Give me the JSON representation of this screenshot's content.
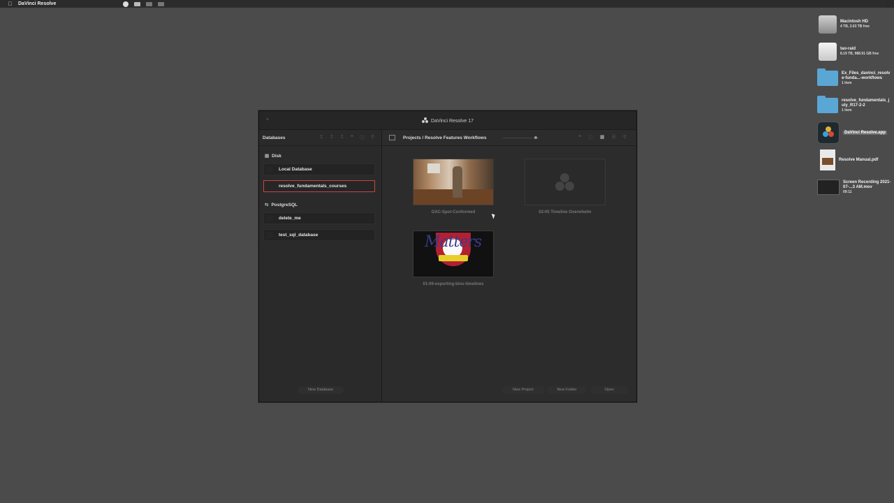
{
  "menubar": {
    "app_name": "DaVinci Resolve"
  },
  "desktop": {
    "items": [
      {
        "name": "Macintosh HD",
        "sub": "4 TB, 3.03 TB free"
      },
      {
        "name": "tao-raid",
        "sub": "8.19 TB, 988.91 GB free"
      },
      {
        "name": "Ex_Files_davinci_resolve-funda...-workflows",
        "sub": "1 item"
      },
      {
        "name": "resolve_fundamentals_july_R17-2-2",
        "sub": "1 item"
      },
      {
        "name": "DaVinci Resolve.app",
        "sub": ""
      },
      {
        "name": "Resolve Manual.pdf",
        "sub": ""
      },
      {
        "name": "Screen Recording 2021-07-...3 AM.mov",
        "sub": "09:11"
      }
    ]
  },
  "window": {
    "title": "DaVinci Resolve 17",
    "close_glyph": "×"
  },
  "databases": {
    "header": "Databases",
    "groups": [
      {
        "label": "Disk",
        "items": [
          "Local Database",
          "resolve_fundamentals_courses"
        ]
      },
      {
        "label": "PostgreSQL",
        "items": [
          "delete_me",
          "test_sql_database"
        ]
      }
    ],
    "selected": "resolve_fundamentals_courses",
    "new_button": "New Database"
  },
  "projects": {
    "breadcrumb": "Projects / Resolve Features Workflows",
    "items": [
      {
        "name": "OAC-Spot-Conformed"
      },
      {
        "name": "02-05 Timeline Overwhelm"
      },
      {
        "name": "01-09-exporting-bins-timelines",
        "thumb_text": "Matters"
      }
    ],
    "buttons": {
      "new_project": "New Project",
      "new_folder": "New Folder",
      "open": "Open"
    }
  }
}
